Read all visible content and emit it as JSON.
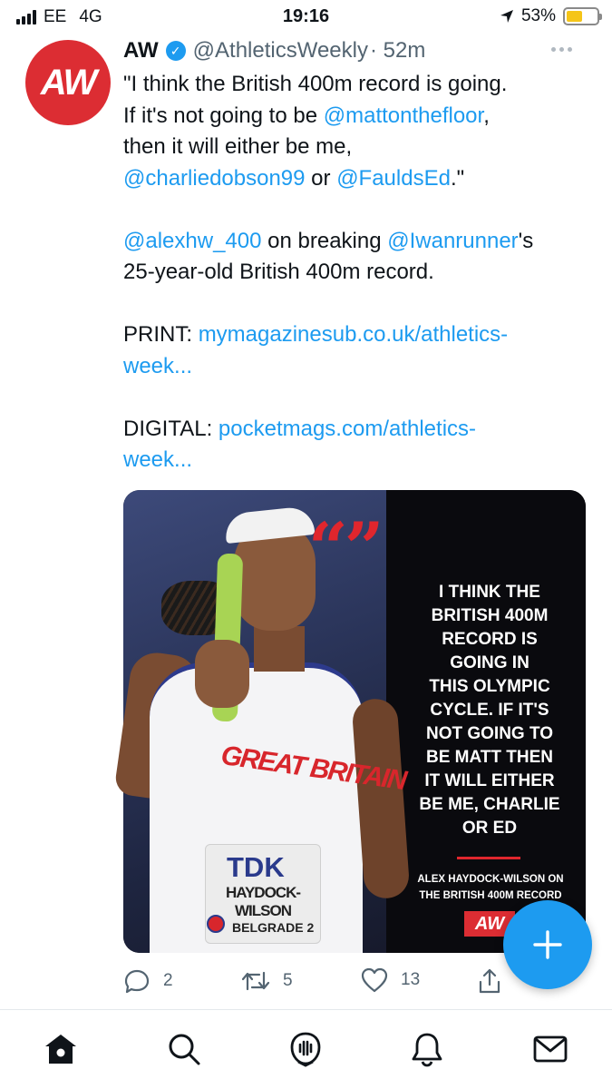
{
  "status_bar": {
    "carrier": "EE",
    "network": "4G",
    "time": "19:16",
    "battery": "53%",
    "battery_level": 0.53,
    "battery_color": "#f5c518"
  },
  "tweet": {
    "avatar_text": "AW",
    "display_name": "AW",
    "handle": "@AthleticsWeekly",
    "time_ago": "· 52m",
    "more_icon": "more-horizontal-icon",
    "lines": {
      "l1": "\"I think the British 400m record is going.",
      "l2_pre": "If it's not going to be ",
      "l2_link": "@mattonthefloor",
      "l2_post": ",",
      "l3": "then it will either be me,",
      "l4_link1": "@charliedobson99",
      "l4_mid": " or ",
      "l4_link2": "@FauldsEd",
      "l4_post": ".\"",
      "l5_link1": "@alexhw_400",
      "l5_mid": " on breaking ",
      "l5_link2": "@Iwanrunner",
      "l5_post": "'s",
      "l6": "25-year-old British 400m record.",
      "l7_pre": "PRINT: ",
      "l7_link": "mymagazinesub.co.uk/athletics-",
      "l8_link": "week...",
      "l9_pre": "DIGITAL: ",
      "l9_link": "pocketmags.com/athletics-",
      "l10_link": "week..."
    },
    "link_color": "#1d9bf0"
  },
  "image": {
    "quote_marks": "“”",
    "quote_lines": [
      "I THINK THE",
      "BRITISH 400M",
      "RECORD IS",
      "GOING IN",
      "THIS OLYMPIC",
      "CYCLE. IF IT'S",
      "NOT GOING TO",
      "BE MATT THEN",
      "IT WILL EITHER",
      "BE ME, CHARLIE",
      "OR ED"
    ],
    "credit_line1": "ALEX HAYDOCK-WILSON ON",
    "credit_line2": "THE BRITISH 400M RECORD",
    "logo": "AW",
    "vest_text": "GREAT BRITAIN",
    "bib_brand": "TDK",
    "bib_name": "HAYDOCK-WILSON",
    "bib_event": "BELGRADE 2"
  },
  "actions": {
    "reply_count": "2",
    "retweet_count": "5",
    "like_count": "13"
  },
  "tabs": [
    "home-icon",
    "search-icon",
    "spaces-icon",
    "notifications-icon",
    "messages-icon"
  ],
  "accent_color": "#1d9bf0"
}
